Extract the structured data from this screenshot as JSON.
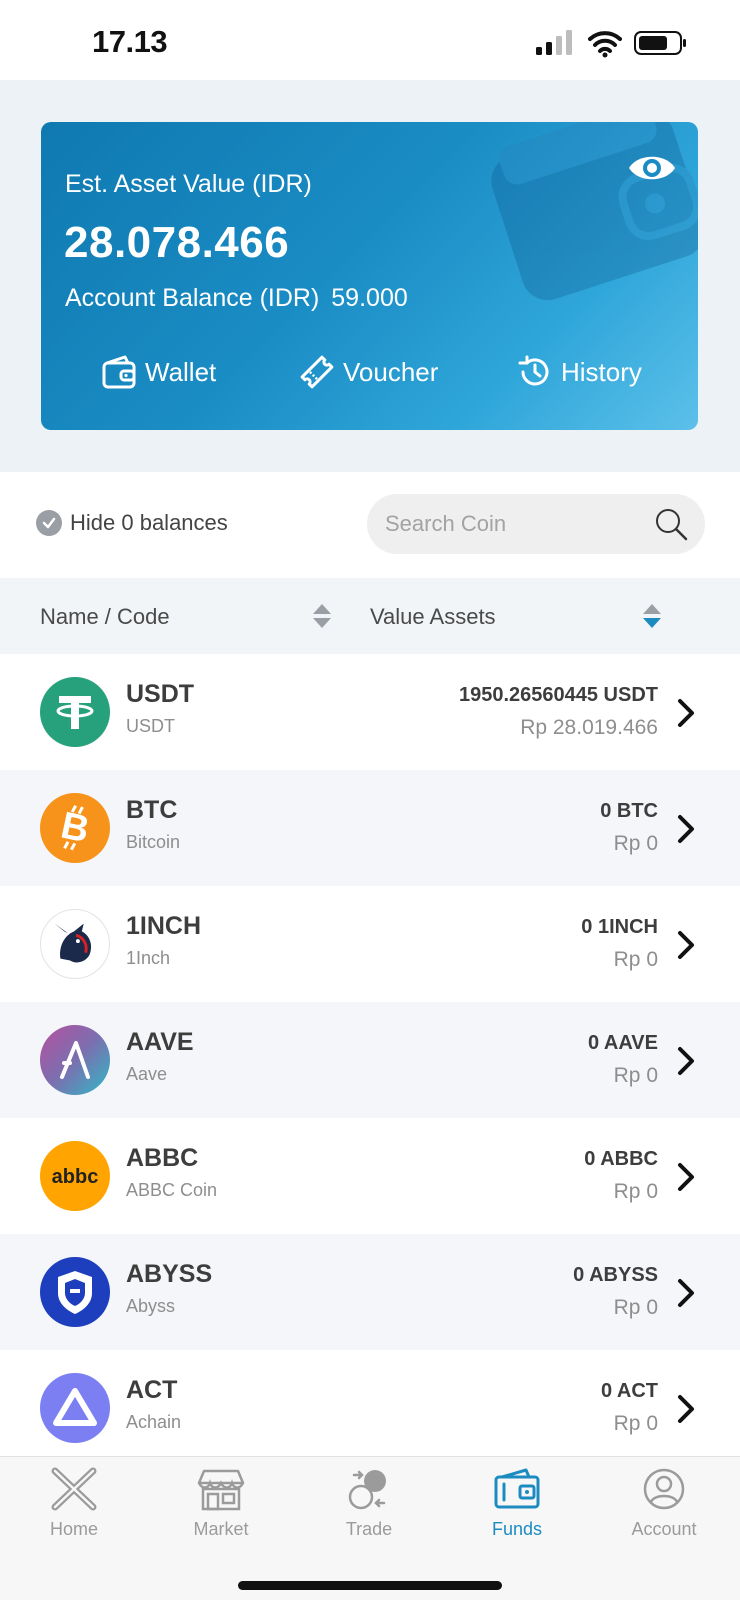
{
  "status_bar": {
    "time": "17.13"
  },
  "hero": {
    "est_label": "Est. Asset Value (IDR)",
    "est_value": "28.078.466",
    "account_label": "Account Balance (IDR)",
    "account_value": "59.000",
    "actions": [
      {
        "label": "Wallet",
        "icon": "wallet-icon"
      },
      {
        "label": "Voucher",
        "icon": "ticket-icon"
      },
      {
        "label": "History",
        "icon": "history-icon"
      }
    ],
    "gradient_start": "#0f79b0",
    "gradient_end": "#5cc0ea"
  },
  "filter": {
    "hide_zero_label": "Hide 0 balances",
    "search_placeholder": "Search Coin",
    "search_value": ""
  },
  "table_header": {
    "name_code": "Name / Code",
    "value_assets": "Value Assets",
    "accent": "#1c8bc0"
  },
  "coins": [
    {
      "code": "USDT",
      "name": "USDT",
      "amount": "1950.26560445 USDT",
      "idr": "Rp 28.019.466",
      "color": "#26a17b"
    },
    {
      "code": "BTC",
      "name": "Bitcoin",
      "amount": "0 BTC",
      "idr": "Rp 0",
      "color": "#f7931a"
    },
    {
      "code": "1INCH",
      "name": "1Inch",
      "amount": "0 1INCH",
      "idr": "Rp 0",
      "color": "#ffffff"
    },
    {
      "code": "AAVE",
      "name": "Aave",
      "amount": "0 AAVE",
      "idr": "Rp 0",
      "color": "#b6509e"
    },
    {
      "code": "ABBC",
      "name": "ABBC Coin",
      "amount": "0 ABBC",
      "idr": "Rp 0",
      "color": "#ffa400"
    },
    {
      "code": "ABYSS",
      "name": "Abyss",
      "amount": "0 ABYSS",
      "idr": "Rp 0",
      "color": "#1e3fbd"
    },
    {
      "code": "ACT",
      "name": "Achain",
      "amount": "0 ACT",
      "idr": "Rp 0",
      "color": "#7b7ff2"
    }
  ],
  "bottom_nav": [
    {
      "label": "Home",
      "icon": "home-x-icon",
      "active": false
    },
    {
      "label": "Market",
      "icon": "store-icon",
      "active": false
    },
    {
      "label": "Trade",
      "icon": "trade-icon",
      "active": false
    },
    {
      "label": "Funds",
      "icon": "wallet-icon",
      "active": true
    },
    {
      "label": "Account",
      "icon": "user-icon",
      "active": false
    }
  ]
}
